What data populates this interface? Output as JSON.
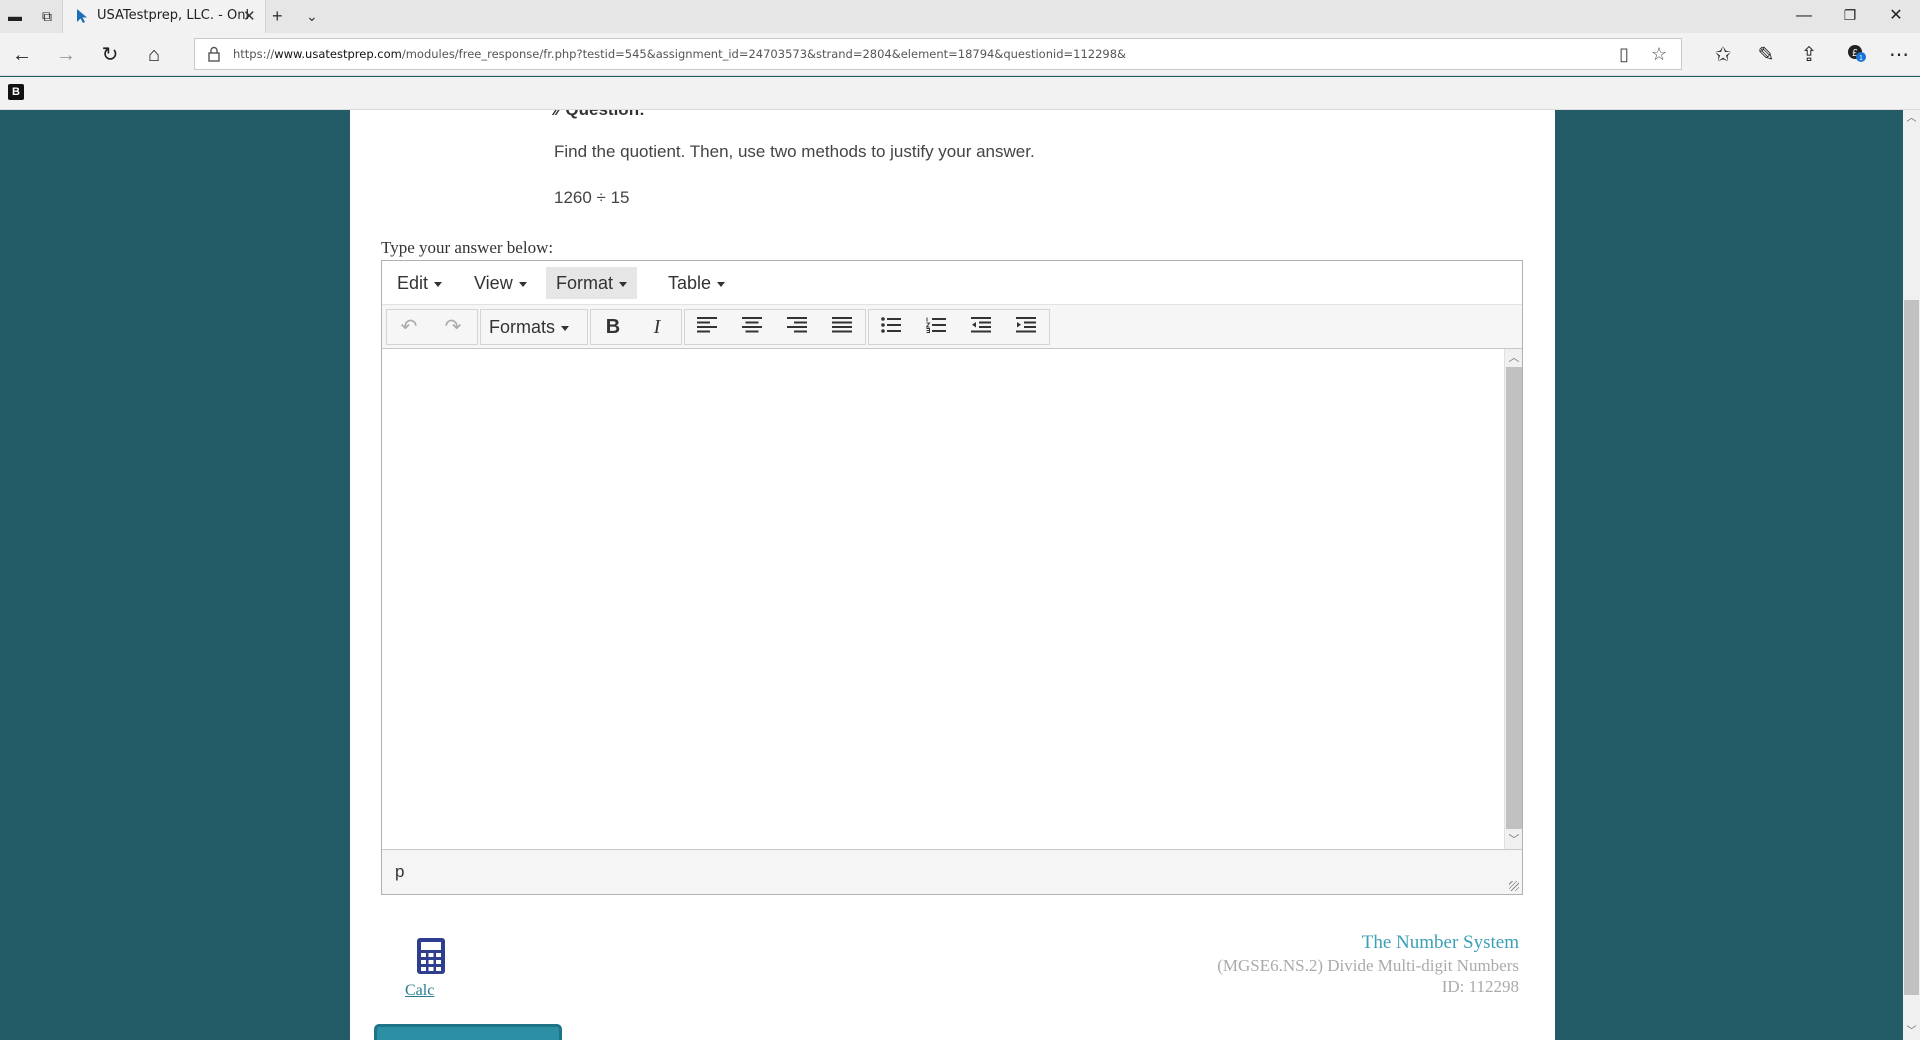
{
  "browser": {
    "tab_title": "USATestprep, LLC. - Onl",
    "url_prefix": "https://",
    "url_host": "www.usatestprep.com",
    "url_path": "/modules/free_response/fr.php?testid=545&assignment_id=24703573&strand=2804&element=18794&questionid=112298&",
    "extensions_badge": "1"
  },
  "question": {
    "heading": "Question:",
    "text": "Find the quotient. Then, use two methods to justify your answer.",
    "expression": "1260 ÷ 15"
  },
  "answer_label": "Type your answer below:",
  "editor": {
    "menu": [
      "Edit",
      "View",
      "Format",
      "Table"
    ],
    "formats_label": "Formats",
    "bold_label": "B",
    "italic_label": "I",
    "path": "p"
  },
  "calc_label": "Calc",
  "standard": {
    "strand": "The Number System",
    "element": "(MGSE6.NS.2) Divide Multi-digit Numbers",
    "id": "ID: 112298"
  },
  "colors": {
    "page_bg": "#235c67",
    "accent": "#3a9fb7",
    "link": "#2a7b8c",
    "calc_icon": "#2e3f8f"
  }
}
